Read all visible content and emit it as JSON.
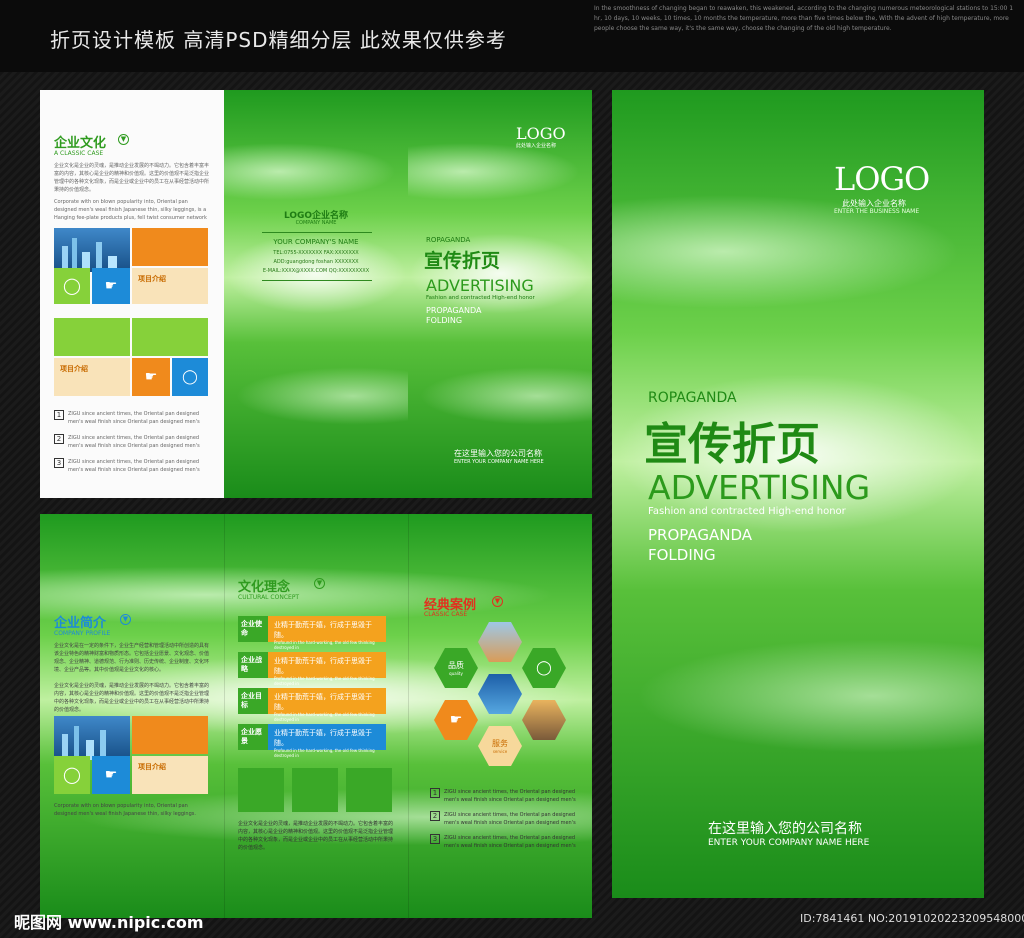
{
  "header": {
    "title": "折页设计模板 高清PSD精细分层 此效果仅供参考",
    "fine_print": "In the smoothness of changing began to reawaken, this weakened, according to the changing numerous meteorological stations to 15:00 1 hr, 10 days, 10 weeks, 10 times, 10 months the temperature, more than five times below the, With the advent of high temperature, more people choose the same way, it's the same way, choose the changing of the old high temperature."
  },
  "footer": {
    "site": "昵图网 www.nipic.com",
    "id": "ID:7841461 NO:20191020223209548000"
  },
  "cover": {
    "logo": "LOGO",
    "logo_sub": "此处输入企业名称",
    "logo_en": "ENTER THE BUSINESS NAME",
    "kicker": "ROPAGANDA",
    "title_cn": "宣传折页",
    "title_en": "ADVERTISING",
    "tagline": "Fashion and contracted High-end honor",
    "sub1": "PROPAGANDA",
    "sub2": "FOLDING",
    "company_cn": "在这里输入您的公司名称",
    "company_en": "ENTER YOUR COMPANY NAME HERE"
  },
  "front_sheet": {
    "culture_title": "企业文化",
    "culture_sub": "A CLASSIC CASE",
    "culture_body": "企业文化是企业的灵魂，是推动企业发展的不竭动力。它包含着丰富丰富的内容，其核心是企业的精神和价值观。这里的价值观不是泛指企业管理中的各种文化现象，而是企业或企业中的员工在从事经营活动中所秉持的价值观念。",
    "culture_en": "Corporate with on blown popularity into, Oriental pan designed men's weal finish Japanese thin, silky leggings, is a Hanging fee-plate products plus, fell twist consumer network network.",
    "box_label": "项目介绍",
    "list": [
      {
        "n": "1",
        "text": "ZIGU since ancient times, the Oriental pan designed men's weal finish since Oriental pan designed men's weal, with natural"
      },
      {
        "n": "2",
        "text": "ZIGU since ancient times, the Oriental pan designed men's weal finish since Oriental pan designed men's weal, with natural"
      },
      {
        "n": "3",
        "text": "ZIGU since ancient times, the Oriental pan designed men's weal finish since Oriental pan designed men's weal, with natural"
      }
    ],
    "back_logo": "LOGO企业名称",
    "back_logo_en": "COMPANY NAME",
    "back_company": "YOUR COMPANY'S NAME",
    "back_tel": "TEL:0755-XXXXXXX  FAX:XXXXXXX",
    "back_addr": "ADD:guangdong foshan XXXXXXX",
    "back_mail": "E-MAIL:XXXX@XXXX.COM  QQ:XXXXXXXXX",
    "mini_logo": "LOGO",
    "mini_logo_sub": "此处输入企业名称",
    "mini_kicker": "ROPAGANDA",
    "mini_title_cn": "宣传折页",
    "mini_title_en": "ADVERTISING",
    "mini_tagline": "Fashion and contracted High-end honor",
    "mini_sub1": "PROPAGANDA",
    "mini_sub2": "FOLDING",
    "mini_company_cn": "在这里输入您的公司名称",
    "mini_company_en": "ENTER YOUR COMPANY NAME HERE"
  },
  "inside_sheet": {
    "profile_title": "企业简介",
    "profile_sub": "COMPANY PROFILE",
    "profile_body": "企业文化是在一定的条件下，企业生产经营和管理活动中所创造的具有该企业特色的精神财富和物质形态。它包括企业愿景、文化观念、价值观念、企业精神、道德规范、行为准则、历史传统、企业制度、文化环境、企业产品等。其中价值观是企业文化的核心。",
    "profile_body2": "企业文化是企业的灵魂，是推动企业发展的不竭动力。它包含着丰富的内容，其核心是企业的精神和价值观。这里的价值观不是泛指企业管理中的各种文化现象，而是企业或企业中的员工在从事经营活动中所秉持的价值观念。",
    "box_label": "项目介绍",
    "profile_en": "Corporate with on blown popularity into, Oriental pan designed men's weal finish Japanese thin, silky leggings.",
    "concept_title": "文化理念",
    "concept_sub": "CULTURAL CONCEPT",
    "concepts": [
      {
        "tag": "企业使命",
        "text": "业精于勤荒于嬉，行成于思毁于随。",
        "en": "Profound in the hard-working, the old few thinking destroyed in"
      },
      {
        "tag": "企业战略",
        "text": "业精于勤荒于嬉，行成于思毁于随。",
        "en": "Profound in the hard-working, the old few thinking destroyed in"
      },
      {
        "tag": "企业目标",
        "text": "业精于勤荒于嬉，行成于思毁于随。",
        "en": "Profound in the hard-working, the old few thinking destroyed in"
      },
      {
        "tag": "企业愿景",
        "text": "业精于勤荒于嬉，行成于思毁于随。",
        "en": "Profound in the hard-working, the old few thinking destroyed in"
      }
    ],
    "concept_body": "企业文化是企业的灵魂，是推动企业发展的不竭动力。它包含着丰富的内容，其核心是企业的精神和价值观。这里的价值观不是泛指企业管理中的各种文化现象，而是企业或企业中的员工在从事经营活动中所秉持的价值观念。",
    "cases_title": "经典案例",
    "cases_sub": "CLASSIC CASE",
    "hex_quality": "品质",
    "hex_quality_en": "quality",
    "hex_service": "服务",
    "hex_service_en": "service",
    "list": [
      {
        "n": "1",
        "text": "ZIGU since ancient times, the Oriental pan designed men's weal finish since Oriental pan designed men's weal, with natural"
      },
      {
        "n": "2",
        "text": "ZIGU since ancient times, the Oriental pan designed men's weal finish since Oriental pan designed men's weal, with natural"
      },
      {
        "n": "3",
        "text": "ZIGU since ancient times, the Oriental pan designed men's weal finish since Oriental pan designed men's weal, with natural"
      }
    ]
  },
  "colors": {
    "green": "#3aa827",
    "orange": "#f08a1c",
    "blue": "#1d8bd8",
    "lime": "#86d13a"
  }
}
